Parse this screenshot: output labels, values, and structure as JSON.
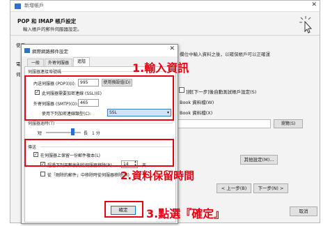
{
  "back_window": {
    "title": "新增帳戶",
    "close": "✕",
    "heading": "POP 和 IMAP 帳戶設定",
    "subheading": "輸入帳戶的郵件伺服器設定。",
    "left_label_1": "使用",
    "left_label_2": "電",
    "left_label_3": "伺",
    "right_hint": "欄位中輸入資料之後，以確保帳戶可以正確運",
    "checkbox_text": "]按[下一步]後自動測試帳戶設定(S)",
    "file_line_1": "Book 資料檔(W)",
    "file_line_2": "Book 資料檔(X)",
    "browse_label": "瀏覽(S)",
    "more_settings_label": "其他設定(M)...",
    "prev_label": "< 上一步(B)",
    "next_label": "下一步(N) >",
    "cancel_label": "取消",
    "cursor_icon": "pointer-cursor-icon"
  },
  "dialog": {
    "title": "網際網路郵件設定",
    "close": "✕",
    "tabs": [
      "一般",
      "外寄伺服器",
      "進階"
    ],
    "active_tab": "進階",
    "server_ports_group": "伺服器連接埠號碼",
    "incoming_label": "內送伺服器 (POP3)(I):",
    "incoming_value": "995",
    "use_defaults_label": "使用預設值(D)",
    "ssl_checkbox_label": "此伺服器需要加密連線 (SSL)(E)",
    "ssl_checked": true,
    "outgoing_label": "外寄伺服器 (SMTP)(O):",
    "outgoing_value": "465",
    "encryption_label": "使用下列加密連線類型(C):",
    "encryption_value": "SSL",
    "timeout_group": "伺服器逾時(T)",
    "timeout_short": "短",
    "timeout_long": "長",
    "timeout_value": "1 分",
    "delivery_group": "傳送",
    "leave_copy_label": "在伺服器上保留一份郵件複本(L)",
    "leave_copy_checked": true,
    "remove_after_label": "超過下列天數後則從伺服器移除(R)",
    "remove_after_checked": true,
    "remove_after_days": "14",
    "days_unit": "天",
    "remove_deleted_label": "從「刪除的郵件」中移除時從伺服器移除(M)",
    "remove_deleted_checked": false,
    "ok_label": "確定"
  },
  "annotations": {
    "step1": "1.輸入資訊",
    "step2": "2.資料保留時間",
    "step3": "3.點選『確定』",
    "color": "#e60012"
  }
}
